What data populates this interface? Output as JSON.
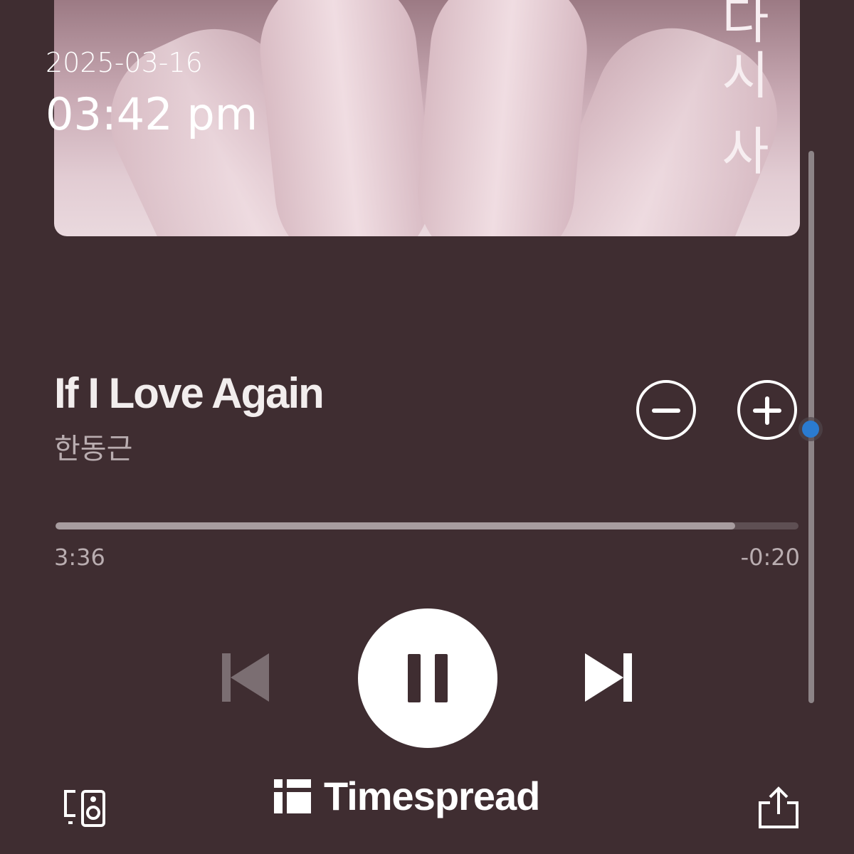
{
  "status": {
    "date": "2025-03-16",
    "time": "03:42 pm"
  },
  "album": {
    "cover_text": "다시 사"
  },
  "track": {
    "title": "If I Love Again",
    "artist": "한동근"
  },
  "playback": {
    "elapsed": "3:36",
    "remaining": "-0:20",
    "progress": 0.915,
    "state": "playing"
  },
  "controls": {
    "minus_icon": "minus-circle-icon",
    "plus_icon": "plus-circle-icon",
    "prev_icon": "skip-previous-icon",
    "play_pause_icon": "pause-icon",
    "next_icon": "skip-next-icon",
    "devices_icon": "devices-icon",
    "share_icon": "share-icon"
  },
  "watermark": {
    "text": "Timespread"
  },
  "colors": {
    "background": "#3f2d31",
    "accent_cursor": "#2a7bd0"
  }
}
